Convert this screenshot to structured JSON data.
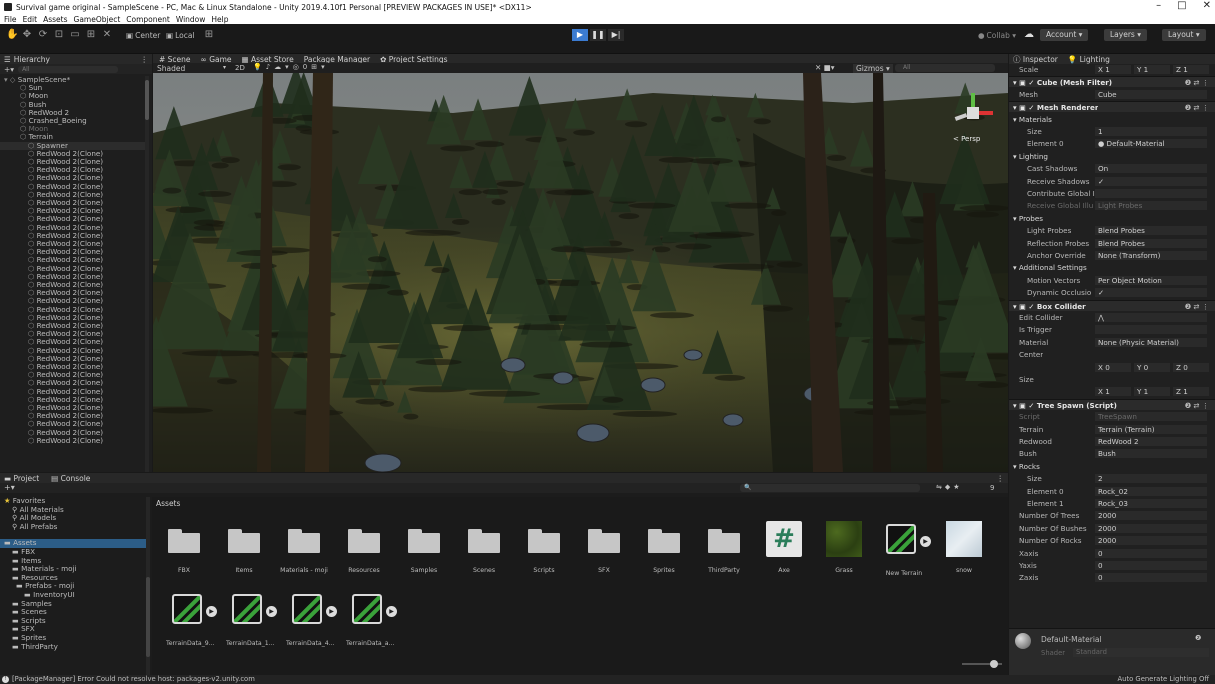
{
  "window": {
    "title": "Survival game original - SampleScene - PC, Mac & Linux Standalone - Unity 2019.4.10f1 Personal [PREVIEW PACKAGES IN USE]* <DX11>",
    "min": "–",
    "max": "□",
    "close": "✕"
  },
  "menu": [
    "File",
    "Edit",
    "Assets",
    "GameObject",
    "Component",
    "Window",
    "Help"
  ],
  "toolbar": {
    "center": "Center",
    "local": "Local",
    "collab": "Collab ▾",
    "account": "Account",
    "layers": "Layers",
    "layout": "Layout"
  },
  "hierarchy": {
    "tab": "Hierarchy",
    "search_placeholder": "All",
    "rows": [
      {
        "label": "SampleScene*",
        "indent": 0,
        "kind": "scene"
      },
      {
        "label": "Sun",
        "indent": 2
      },
      {
        "label": "Moon",
        "indent": 2
      },
      {
        "label": "Bush",
        "indent": 2
      },
      {
        "label": "RedWood 2",
        "indent": 2
      },
      {
        "label": "Crashed_Boeing",
        "indent": 2
      },
      {
        "label": "Moon",
        "indent": 2,
        "dim": true
      },
      {
        "label": "Terrain",
        "indent": 2
      },
      {
        "label": "Spawner",
        "indent": 3,
        "sel": true
      },
      {
        "label": "RedWood 2(Clone)",
        "indent": 3,
        "repeat": 36
      }
    ]
  },
  "scene": {
    "tabs": [
      "Scene",
      "Game",
      "Asset Store",
      "Package Manager",
      "Project Settings"
    ],
    "shading": "Shaded",
    "mode2d": "2D",
    "gizmos": "Gizmos",
    "search_placeholder": "All",
    "persp": "< Persp"
  },
  "inspector": {
    "tabs": [
      "Inspector",
      "Lighting"
    ],
    "rows": [
      {
        "k": "Scale",
        "x": "X 1",
        "y": "Y 1",
        "z": "Z 1",
        "type": "xyz"
      },
      {
        "k": "Cube (Mesh Filter)",
        "type": "comp"
      },
      {
        "k": "Mesh",
        "v": "Cube"
      },
      {
        "k": "Mesh Renderer",
        "type": "comp"
      },
      {
        "k": "Materials",
        "type": "sec"
      },
      {
        "k": "Size",
        "v": "1",
        "in": true
      },
      {
        "k": "Element 0",
        "v": "● Default-Material",
        "in": true
      },
      {
        "k": "Lighting",
        "type": "sec"
      },
      {
        "k": "Cast Shadows",
        "v": "On",
        "in": true
      },
      {
        "k": "Receive Shadows",
        "v": "✓",
        "in": true
      },
      {
        "k": "Contribute Global I",
        "v": "",
        "in": true
      },
      {
        "k": "Receive Global Illu",
        "v": "Light Probes",
        "in": true,
        "dim": true
      },
      {
        "k": "Probes",
        "type": "sec"
      },
      {
        "k": "Light Probes",
        "v": "Blend Probes",
        "in": true
      },
      {
        "k": "Reflection Probes",
        "v": "Blend Probes",
        "in": true
      },
      {
        "k": "Anchor Override",
        "v": "None (Transform)",
        "in": true
      },
      {
        "k": "Additional Settings",
        "type": "sec"
      },
      {
        "k": "Motion Vectors",
        "v": "Per Object Motion",
        "in": true
      },
      {
        "k": "Dynamic Occlusio",
        "v": "✓",
        "in": true
      },
      {
        "k": "Box Collider",
        "type": "comp"
      },
      {
        "k": "Edit Collider",
        "v": "⋀"
      },
      {
        "k": "Is Trigger",
        "v": ""
      },
      {
        "k": "Material",
        "v": "None (Physic Material)"
      },
      {
        "k": "Center",
        "type": "plain"
      },
      {
        "k": "",
        "x": "X 0",
        "y": "Y 0",
        "z": "Z 0",
        "type": "xyz"
      },
      {
        "k": "Size",
        "type": "plain"
      },
      {
        "k": "",
        "x": "X 1",
        "y": "Y 1",
        "z": "Z 1",
        "type": "xyz"
      },
      {
        "k": "Tree Spawn (Script)",
        "type": "comp"
      },
      {
        "k": "Script",
        "v": "TreeSpawn",
        "dim": true
      },
      {
        "k": "Terrain",
        "v": "Terrain (Terrain)"
      },
      {
        "k": "Redwood",
        "v": "RedWood 2"
      },
      {
        "k": "Bush",
        "v": "Bush"
      },
      {
        "k": "Rocks",
        "type": "sec"
      },
      {
        "k": "Size",
        "v": "2",
        "in": true
      },
      {
        "k": "Element 0",
        "v": "Rock_02",
        "in": true
      },
      {
        "k": "Element 1",
        "v": "Rock_03",
        "in": true
      },
      {
        "k": "Number Of Trees",
        "v": "2000"
      },
      {
        "k": "Number Of Bushes",
        "v": "2000"
      },
      {
        "k": "Number Of Rocks",
        "v": "2000"
      },
      {
        "k": "Xaxis",
        "v": "0"
      },
      {
        "k": "Yaxis",
        "v": "0"
      },
      {
        "k": "Zaxis",
        "v": "0"
      }
    ],
    "material": {
      "name": "Default-Material",
      "shader_label": "Shader",
      "shader": "Standard"
    }
  },
  "project": {
    "tabs": [
      "Project",
      "Console"
    ],
    "search_placeholder": "",
    "count": "9",
    "breadcrumb": "Assets",
    "tree": [
      {
        "label": "Favorites",
        "indent": 0,
        "kind": "star"
      },
      {
        "label": "All Materials",
        "indent": 2,
        "kind": "search"
      },
      {
        "label": "All Models",
        "indent": 2,
        "kind": "search"
      },
      {
        "label": "All Prefabs",
        "indent": 2,
        "kind": "search"
      },
      {
        "label": "",
        "indent": 0,
        "kind": "gap"
      },
      {
        "label": "Assets",
        "indent": 0,
        "kind": "folder",
        "sel": true
      },
      {
        "label": "FBX",
        "indent": 2,
        "kind": "folder"
      },
      {
        "label": "Items",
        "indent": 2,
        "kind": "folder"
      },
      {
        "label": "Materials - moji",
        "indent": 2,
        "kind": "folder"
      },
      {
        "label": "Resources",
        "indent": 2,
        "kind": "folder"
      },
      {
        "label": "Prefabs - moji",
        "indent": 3,
        "kind": "folder"
      },
      {
        "label": "InventoryUI",
        "indent": 5,
        "kind": "folder"
      },
      {
        "label": "Samples",
        "indent": 2,
        "kind": "folder"
      },
      {
        "label": "Scenes",
        "indent": 2,
        "kind": "folder"
      },
      {
        "label": "Scripts",
        "indent": 2,
        "kind": "folder"
      },
      {
        "label": "SFX",
        "indent": 2,
        "kind": "folder"
      },
      {
        "label": "Sprites",
        "indent": 2,
        "kind": "folder"
      },
      {
        "label": "ThirdParty",
        "indent": 2,
        "kind": "folder"
      }
    ],
    "assets_row1": [
      {
        "label": "FBX",
        "kind": "folder"
      },
      {
        "label": "Items",
        "kind": "folder"
      },
      {
        "label": "Materials - moji",
        "kind": "folder"
      },
      {
        "label": "Resources",
        "kind": "folder"
      },
      {
        "label": "Samples",
        "kind": "folder"
      },
      {
        "label": "Scenes",
        "kind": "folder"
      },
      {
        "label": "Scripts",
        "kind": "folder"
      },
      {
        "label": "SFX",
        "kind": "folder"
      },
      {
        "label": "Sprites",
        "kind": "folder"
      },
      {
        "label": "ThirdParty",
        "kind": "folder"
      },
      {
        "label": "Axe",
        "kind": "script"
      },
      {
        "label": "Grass",
        "kind": "grass"
      },
      {
        "label": "New Terrain",
        "kind": "terrain"
      },
      {
        "label": "snow",
        "kind": "snow"
      }
    ],
    "assets_row2": [
      {
        "label": "TerrainData_9...",
        "kind": "terrain"
      },
      {
        "label": "TerrainData_1...",
        "kind": "terrain"
      },
      {
        "label": "TerrainData_4...",
        "kind": "terrain"
      },
      {
        "label": "TerrainData_a...",
        "kind": "terrain"
      }
    ]
  },
  "status": {
    "message": "[PackageManager] Error Could not resolve host: packages-v2.unity.com",
    "right": "Auto Generate Lighting Off"
  },
  "colors": {
    "accent": "#3b7bd1",
    "selection": "#2c5d87"
  }
}
